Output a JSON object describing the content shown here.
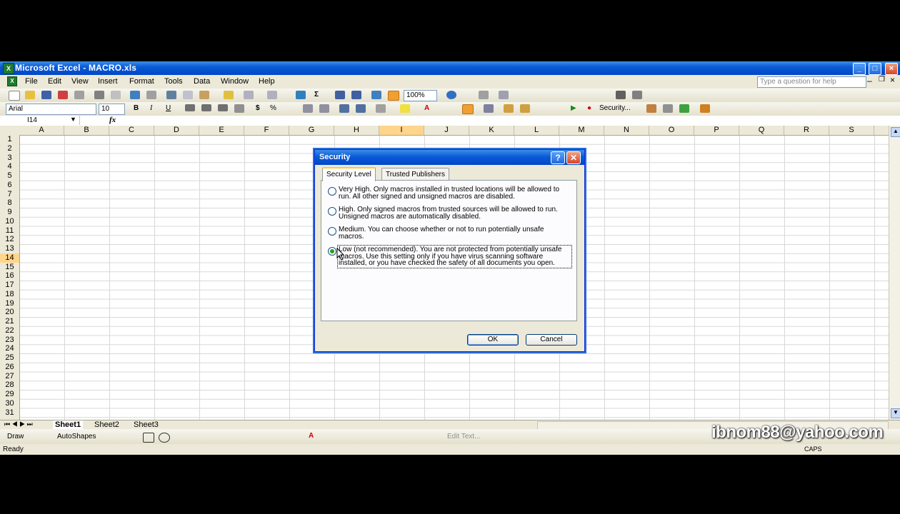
{
  "window": {
    "title": "Microsoft Excel - MACRO.xls",
    "minimize": "_",
    "maximize": "□",
    "close": "×"
  },
  "menu": {
    "items": [
      "File",
      "Edit",
      "View",
      "Insert",
      "Format",
      "Tools",
      "Data",
      "Window",
      "Help"
    ],
    "ask_placeholder": "Type a question for help"
  },
  "toolbar": {
    "zoom": "100%",
    "font": "Arial",
    "size": "10",
    "bold": "B",
    "italic": "I",
    "underline": "U",
    "currency": "$",
    "percent": "%",
    "security_label": "Security..."
  },
  "formula_bar": {
    "name_box": "I14",
    "fx": "fx"
  },
  "grid": {
    "columns": [
      "A",
      "B",
      "C",
      "D",
      "E",
      "F",
      "G",
      "H",
      "I",
      "J",
      "K",
      "L",
      "M",
      "N",
      "O",
      "P",
      "Q",
      "R",
      "S"
    ],
    "selected_column": "I",
    "rows": [
      "1",
      "2",
      "3",
      "4",
      "5",
      "6",
      "7",
      "8",
      "9",
      "10",
      "11",
      "12",
      "13",
      "14",
      "15",
      "16",
      "17",
      "18",
      "19",
      "20",
      "21",
      "22",
      "23",
      "24",
      "25",
      "26",
      "27",
      "28",
      "29",
      "30",
      "31"
    ],
    "selected_row": "14"
  },
  "sheet_tabs": [
    "Sheet1",
    "Sheet2",
    "Sheet3"
  ],
  "draw_toolbar": {
    "draw": "Draw",
    "autoshapes": "AutoShapes",
    "edit_text": "Edit Text..."
  },
  "status": {
    "left": "Ready",
    "caps": "CAPS"
  },
  "watermark": "ibnom88@yahoo.com",
  "dialog": {
    "title": "Security",
    "help": "?",
    "close": "✕",
    "tabs": [
      "Security Level",
      "Trusted Publishers"
    ],
    "options": [
      {
        "label": "Very High. Only macros installed in trusted locations will be allowed to run. All other signed and unsigned macros are disabled.",
        "selected": false
      },
      {
        "label": "High. Only signed macros from trusted sources will be allowed to run. Unsigned macros are automatically disabled.",
        "selected": false
      },
      {
        "label": "Medium. You can choose whether or not to run potentially unsafe macros.",
        "selected": false
      },
      {
        "label": "Low (not recommended). You are not protected from potentially unsafe macros. Use this setting only if you have virus scanning software installed, or you have checked the safety of all documents you open.",
        "selected": true
      }
    ],
    "ok": "OK",
    "cancel": "Cancel"
  }
}
